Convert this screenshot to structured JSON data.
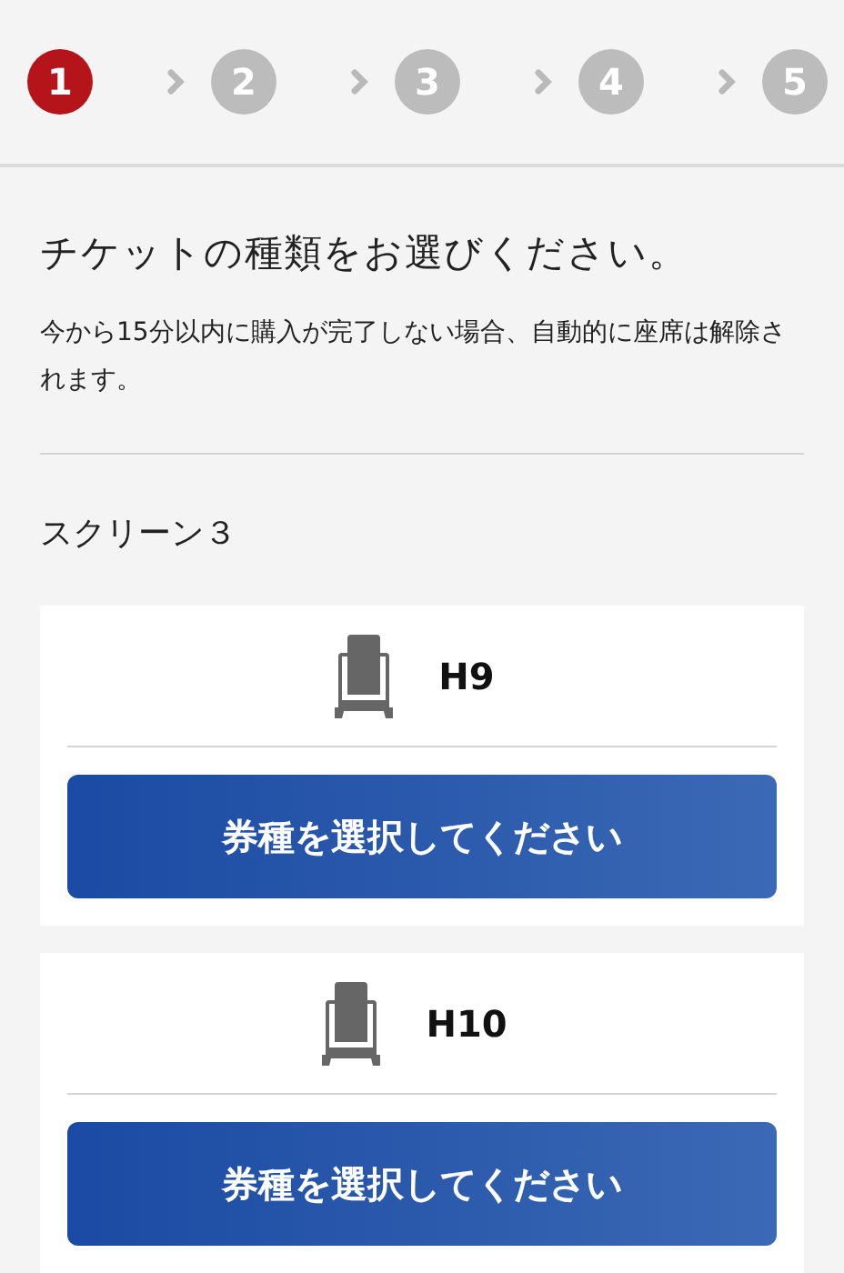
{
  "steps": [
    {
      "label": "1",
      "selected": true
    },
    {
      "label": "2",
      "selected": false
    },
    {
      "label": "3",
      "selected": false
    },
    {
      "label": "4",
      "selected": false
    },
    {
      "label": "5",
      "selected": false
    }
  ],
  "title": "チケットの種類をお選びください。",
  "note": "今から15分以内に購入が完了しない場合、自動的に座席は解除されます。",
  "screen": "スクリーン３",
  "seats": [
    {
      "seat": "H9",
      "button": "券種を選択してください"
    },
    {
      "seat": "H10",
      "button": "券種を選択してください"
    }
  ]
}
